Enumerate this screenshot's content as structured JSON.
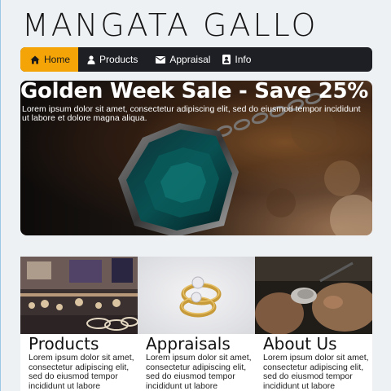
{
  "brand": {
    "name": "MANGATA GALLO"
  },
  "nav": {
    "items": [
      {
        "label": "Home",
        "icon": "home-icon",
        "active": true
      },
      {
        "label": "Products",
        "icon": "user-icon",
        "active": false
      },
      {
        "label": "Appraisal",
        "icon": "envelope-icon",
        "active": false
      },
      {
        "label": "Info",
        "icon": "contact-card-icon",
        "active": false
      }
    ],
    "colors": {
      "bar": "#1d1f24",
      "active": "#f4a407"
    }
  },
  "hero": {
    "title": "Golden Week Sale - Save 25%",
    "text": "Lorem ipsum dolor sit amet, consectetur adipiscing elit, sed do eiusmod tempor incididunt ut labore et dolore magna aliqua."
  },
  "cards": [
    {
      "title": "Products",
      "text": "Lorem ipsum dolor sit amet, consectetur adipiscing elit, sed do eiusmod tempor incididunt ut labore"
    },
    {
      "title": "Appraisals",
      "text": "Lorem ipsum dolor sit amet, consectetur adipiscing elit, sed do eiusmod tempor incididunt ut labore"
    },
    {
      "title": "About Us",
      "text": "Lorem ipsum dolor sit amet, consectetur adipiscing elit, sed do eiusmod tempor incididunt ut labore"
    }
  ]
}
